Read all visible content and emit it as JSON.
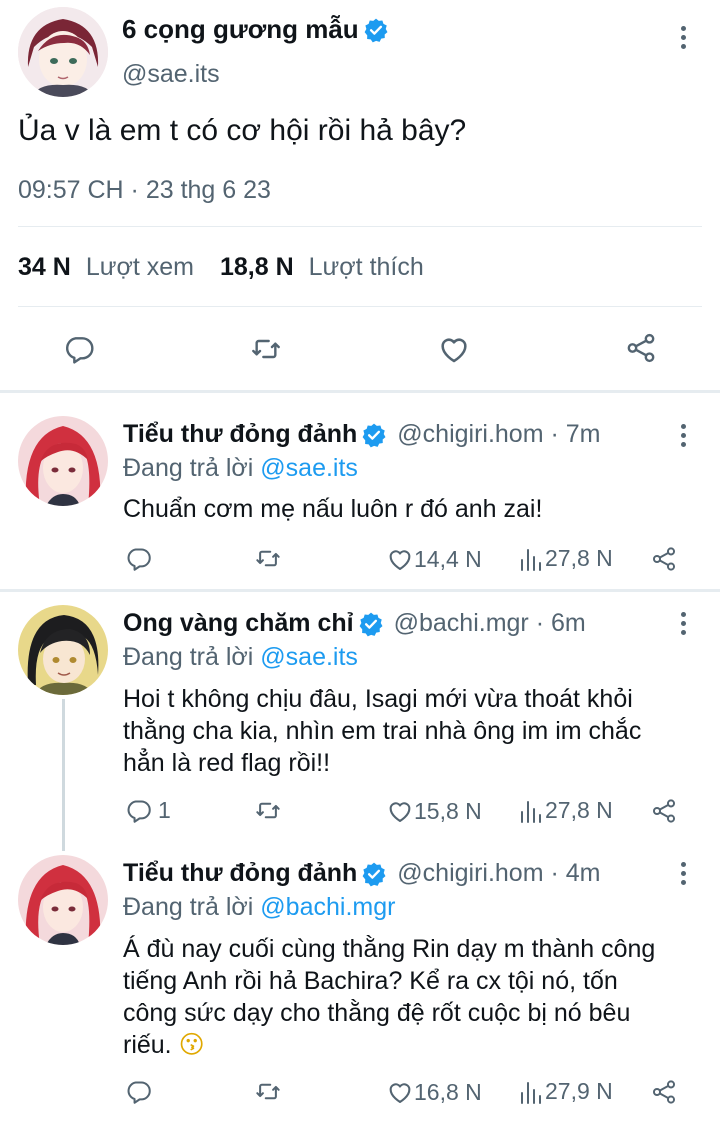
{
  "main_tweet": {
    "display_name": "6 cọng gương mẫu",
    "handle": "@sae.its",
    "text": "Ủa v là em t có cơ hội rồi hả bây?",
    "timestamp": "09:57 CH · 23 thg 6 23",
    "views_count": "34 N",
    "views_label": "Lượt xem",
    "likes_count": "18,8 N",
    "likes_label": "Lượt thích"
  },
  "replies": [
    {
      "display_name": "Tiểu thư đỏng đảnh",
      "handle_time": "@chigiri.hom · 7m",
      "replying_prefix": "Đang trả lời",
      "replying_to": "@sae.its",
      "text_lines": [
        "Chuẩn cơm mẹ nấu luôn r đó anh zai!"
      ],
      "reply_count": "",
      "like_count": "14,4 N",
      "view_count": "27,8 N"
    },
    {
      "display_name": "Ong vàng chăm chỉ",
      "handle_time": "@bachi.mgr · 6m",
      "replying_prefix": "Đang trả lời",
      "replying_to": "@sae.its",
      "text_lines": [
        "Hoi t không chịu đâu, Isagi mới vừa thoát khỏi",
        "thằng cha kia, nhìn em trai nhà ông im im chắc",
        "hẳn là red flag rồi!!"
      ],
      "reply_count": "1",
      "like_count": "15,8 N",
      "view_count": "27,8 N"
    },
    {
      "display_name": "Tiểu thư đỏng đảnh",
      "handle_time": "@chigiri.hom · 4m",
      "replying_prefix": "Đang trả lời",
      "replying_to": "@bachi.mgr",
      "text_lines": [
        "Á đù nay cuối cùng thằng Rin dạy m thành công",
        "tiếng Anh rồi hả Bachira? Kể ra cx tội nó, tốn",
        "công sức dạy cho thằng đệ rốt cuộc bị nó bêu",
        "riếu."
      ],
      "emoji": "😗",
      "reply_count": "",
      "like_count": "16,8 N",
      "view_count": "27,9 N"
    }
  ],
  "colors": {
    "link": "#1d9bf0",
    "muted": "#536471",
    "divider": "#e6ecf0",
    "verified": "#1d9bf0"
  },
  "icons": [
    "verified-badge-icon",
    "more-icon",
    "reply-icon",
    "retweet-icon",
    "like-icon",
    "share-icon",
    "views-icon"
  ]
}
